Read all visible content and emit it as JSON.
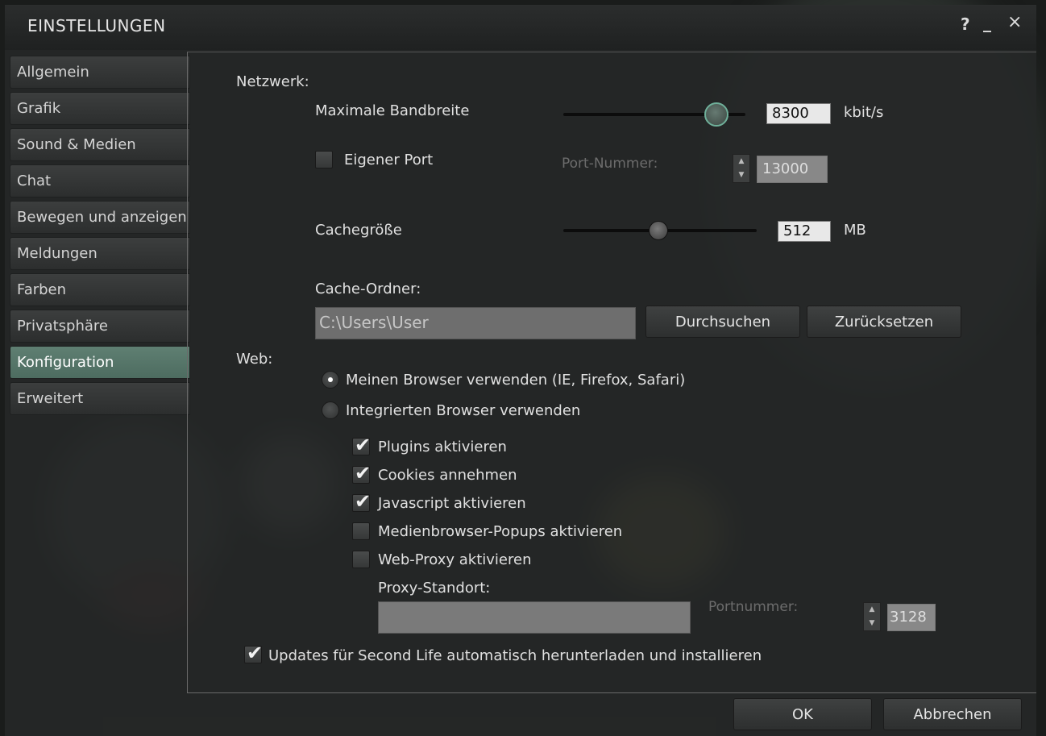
{
  "window": {
    "title": "EINSTELLUNGEN",
    "help": "?",
    "minimize": "_",
    "close": "×"
  },
  "sidebar": {
    "items": [
      {
        "label": "Allgemein"
      },
      {
        "label": "Grafik"
      },
      {
        "label": "Sound & Medien"
      },
      {
        "label": "Chat"
      },
      {
        "label": "Bewegen und anzeigen"
      },
      {
        "label": "Meldungen"
      },
      {
        "label": "Farben"
      },
      {
        "label": "Privatsphäre"
      },
      {
        "label": "Konfiguration"
      },
      {
        "label": "Erweitert"
      }
    ],
    "active_index": 8
  },
  "network": {
    "heading": "Netzwerk:",
    "bandwidth": {
      "label": "Maximale Bandbreite",
      "value": "8300",
      "unit": "kbit/s",
      "slider_fraction": 0.84
    },
    "custom_port": {
      "label": "Eigener Port",
      "checked": false,
      "port_label": "Port-Nummer:",
      "port_value": "13000"
    },
    "cache_size": {
      "label": "Cachegröße",
      "value": "512",
      "unit": "MB",
      "slider_fraction": 0.49
    },
    "cache_folder": {
      "label": "Cache-Ordner:",
      "path": "C:\\Users\\User",
      "browse_button": "Durchsuchen",
      "reset_button": "Zurücksetzen"
    }
  },
  "web": {
    "heading": "Web:",
    "radio_own_browser": {
      "label": "Meinen Browser verwenden (IE, Firefox, Safari)",
      "selected": true
    },
    "radio_builtin_browser": {
      "label": "Integrierten Browser verwenden",
      "selected": false
    },
    "plugins": {
      "label": "Plugins aktivieren",
      "checked": true
    },
    "cookies": {
      "label": "Cookies annehmen",
      "checked": true
    },
    "javascript": {
      "label": "Javascript aktivieren",
      "checked": true
    },
    "media_popups": {
      "label": "Medienbrowser-Popups aktivieren",
      "checked": false
    },
    "web_proxy": {
      "label": "Web-Proxy aktivieren",
      "checked": false
    },
    "proxy_location": {
      "label": "Proxy-Standort:",
      "value": "",
      "port_label": "Portnummer:",
      "port_value": "3128"
    }
  },
  "auto_update": {
    "label": "Updates für Second Life automatisch herunterladen und installieren",
    "checked": true
  },
  "footer": {
    "ok": "OK",
    "cancel": "Abbrechen"
  }
}
